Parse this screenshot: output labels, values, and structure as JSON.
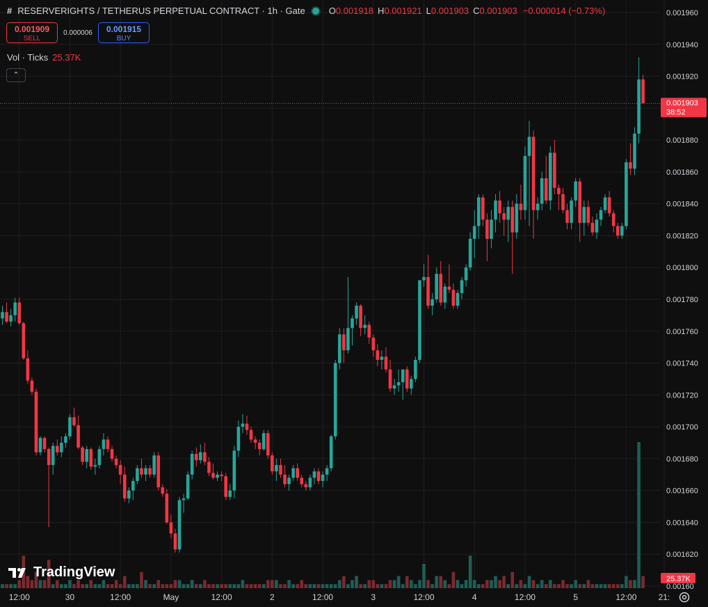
{
  "header": {
    "symbol_icon": "hash-icon",
    "title": "RESERVERIGHTS / TETHERUS PERPETUAL CONTRACT · 1h · Gate",
    "status_color": "#26a69a",
    "ohlc": {
      "o_label": "O",
      "o": "0.001918",
      "h_label": "H",
      "h": "0.001921",
      "l_label": "L",
      "l": "0.001903",
      "c_label": "C",
      "c": "0.001903",
      "change": "−0.000014 (−0.73%)"
    }
  },
  "trade": {
    "sell_price": "0.001909",
    "sell_label": "SELL",
    "spread": "0.000006",
    "buy_price": "0.001915",
    "buy_label": "BUY"
  },
  "volume_legend": {
    "label": "Vol · Ticks",
    "value": "25.37K"
  },
  "collapse_icon": "chevron-up-icon",
  "watermark": {
    "text": "TradingView",
    "icon": "tradingview-logo-icon"
  },
  "price_tag": {
    "price": "0.001903",
    "countdown": "38:52",
    "color": "#f23645"
  },
  "volume_tag": {
    "value": "25.37K",
    "color": "#f23645"
  },
  "colors": {
    "up": "#26a69a",
    "down": "#f23645",
    "up_vol": "#1e5e57",
    "down_vol": "#7a2a30",
    "grid": "#1f1f1f",
    "background": "#0f0f0f"
  },
  "chart_data": {
    "type": "candlestick",
    "ylim": [
      0.0016,
      0.00196
    ],
    "y_ticks": [
      "0.001960",
      "0.001940",
      "0.001920",
      "0.001900",
      "0.001880",
      "0.001860",
      "0.001840",
      "0.001820",
      "0.001800",
      "0.001780",
      "0.001760",
      "0.001740",
      "0.001720",
      "0.001700",
      "0.001680",
      "0.001660",
      "0.001640",
      "0.001620",
      "0.00160"
    ],
    "x_ticks": [
      {
        "label": "12:00",
        "index": 4
      },
      {
        "label": "30",
        "index": 16
      },
      {
        "label": "12:00",
        "index": 28
      },
      {
        "label": "May",
        "index": 40
      },
      {
        "label": "12:00",
        "index": 52
      },
      {
        "label": "2",
        "index": 64
      },
      {
        "label": "12:00",
        "index": 76
      },
      {
        "label": "3",
        "index": 88
      },
      {
        "label": "12:00",
        "index": 100
      },
      {
        "label": "4",
        "index": 112
      },
      {
        "label": "12:00",
        "index": 124
      },
      {
        "label": "5",
        "index": 136
      },
      {
        "label": "12:00",
        "index": 148
      },
      {
        "label": "21:",
        "index": 157
      }
    ],
    "candles": [
      [
        0.001768,
        0.001776,
        0.001764,
        0.001772,
        1
      ],
      [
        0.001772,
        0.001778,
        0.001765,
        0.001766,
        1
      ],
      [
        0.001766,
        0.001774,
        0.001763,
        0.00177,
        1
      ],
      [
        0.00177,
        0.001781,
        0.001766,
        0.001778,
        1
      ],
      [
        0.001778,
        0.001781,
        0.001764,
        0.001765,
        2
      ],
      [
        0.001765,
        0.001766,
        0.001742,
        0.001743,
        8
      ],
      [
        0.001743,
        0.001748,
        0.001727,
        0.001729,
        3
      ],
      [
        0.001729,
        0.001731,
        0.00172,
        0.001722,
        2
      ],
      [
        0.001722,
        0.001724,
        0.001682,
        0.001684,
        4
      ],
      [
        0.001684,
        0.001694,
        0.001682,
        0.001693,
        2
      ],
      [
        0.001693,
        0.001694,
        0.001684,
        0.001686,
        2
      ],
      [
        0.001686,
        0.001687,
        0.001637,
        0.001676,
        7
      ],
      [
        0.001676,
        0.00169,
        0.00167,
        0.001688,
        1
      ],
      [
        0.001688,
        0.001692,
        0.001682,
        0.001684,
        2
      ],
      [
        0.001684,
        0.001694,
        0.001681,
        0.00169,
        1
      ],
      [
        0.00169,
        0.001696,
        0.001687,
        0.001694,
        1
      ],
      [
        0.001694,
        0.001708,
        0.001692,
        0.001706,
        2
      ],
      [
        0.001706,
        0.001712,
        0.0017,
        0.001701,
        1
      ],
      [
        0.001701,
        0.001707,
        0.001686,
        0.001687,
        2
      ],
      [
        0.001687,
        0.001688,
        0.001676,
        0.001678,
        1
      ],
      [
        0.001678,
        0.001688,
        0.001674,
        0.001686,
        1
      ],
      [
        0.001686,
        0.001687,
        0.001673,
        0.001675,
        2
      ],
      [
        0.001675,
        0.00168,
        0.00167,
        0.001676,
        1
      ],
      [
        0.001676,
        0.001688,
        0.001674,
        0.001686,
        1
      ],
      [
        0.001686,
        0.001696,
        0.001682,
        0.001692,
        2
      ],
      [
        0.001692,
        0.001694,
        0.001684,
        0.001686,
        1
      ],
      [
        0.001686,
        0.001688,
        0.001678,
        0.00168,
        1
      ],
      [
        0.00168,
        0.001682,
        0.001674,
        0.001676,
        2
      ],
      [
        0.001676,
        0.001679,
        0.001664,
        0.00167,
        1
      ],
      [
        0.00167,
        0.001675,
        0.001653,
        0.001655,
        3
      ],
      [
        0.001655,
        0.001662,
        0.001652,
        0.00166,
        1
      ],
      [
        0.00166,
        0.001668,
        0.001654,
        0.001666,
        1
      ],
      [
        0.001666,
        0.001676,
        0.001664,
        0.001674,
        1
      ],
      [
        0.001674,
        0.00168,
        0.001668,
        0.00167,
        4
      ],
      [
        0.00167,
        0.001676,
        0.001666,
        0.001674,
        2
      ],
      [
        0.001674,
        0.001676,
        0.001668,
        0.00167,
        1
      ],
      [
        0.00167,
        0.001684,
        0.001668,
        0.001682,
        1
      ],
      [
        0.001682,
        0.001684,
        0.00166,
        0.001662,
        2
      ],
      [
        0.001662,
        0.001664,
        0.001656,
        0.001658,
        1
      ],
      [
        0.001658,
        0.001661,
        0.001639,
        0.00164,
        1
      ],
      [
        0.00164,
        0.001645,
        0.00163,
        0.001633,
        1
      ],
      [
        0.001633,
        0.001636,
        0.001621,
        0.001623,
        2
      ],
      [
        0.001623,
        0.001656,
        0.001621,
        0.001654,
        2
      ],
      [
        0.001654,
        0.001658,
        0.001646,
        0.001655,
        1
      ],
      [
        0.001655,
        0.001672,
        0.001654,
        0.00167,
        1
      ],
      [
        0.00167,
        0.001685,
        0.001667,
        0.001683,
        2
      ],
      [
        0.001683,
        0.001687,
        0.001675,
        0.001679,
        1
      ],
      [
        0.001679,
        0.001689,
        0.001677,
        0.001684,
        1
      ],
      [
        0.001684,
        0.00169,
        0.001676,
        0.001678,
        2
      ],
      [
        0.001678,
        0.001681,
        0.001669,
        0.001671,
        1
      ],
      [
        0.001671,
        0.001677,
        0.001667,
        0.001668,
        1
      ],
      [
        0.001668,
        0.001672,
        0.001666,
        0.00167,
        1
      ],
      [
        0.00167,
        0.001672,
        0.001666,
        0.001669,
        1
      ],
      [
        0.001669,
        0.001671,
        0.001654,
        0.001656,
        1
      ],
      [
        0.001656,
        0.001664,
        0.001654,
        0.00166,
        1
      ],
      [
        0.00166,
        0.001688,
        0.001655,
        0.001685,
        1
      ],
      [
        0.001685,
        0.001704,
        0.001681,
        0.0017,
        1
      ],
      [
        0.0017,
        0.001708,
        0.001696,
        0.001702,
        2
      ],
      [
        0.001702,
        0.001707,
        0.001695,
        0.001698,
        1
      ],
      [
        0.001698,
        0.0017,
        0.00169,
        0.001692,
        1
      ],
      [
        0.001692,
        0.001694,
        0.001686,
        0.00169,
        1
      ],
      [
        0.00169,
        0.001692,
        0.001682,
        0.001686,
        1
      ],
      [
        0.001686,
        0.001698,
        0.001685,
        0.001696,
        1
      ],
      [
        0.001696,
        0.001698,
        0.00168,
        0.001682,
        2
      ],
      [
        0.001682,
        0.001684,
        0.00167,
        0.001672,
        2
      ],
      [
        0.001672,
        0.00168,
        0.001666,
        0.001676,
        2
      ],
      [
        0.001676,
        0.00168,
        0.001668,
        0.00167,
        1
      ],
      [
        0.00167,
        0.001676,
        0.001662,
        0.001664,
        1
      ],
      [
        0.001664,
        0.00167,
        0.00166,
        0.001668,
        2
      ],
      [
        0.001668,
        0.001676,
        0.001666,
        0.001674,
        1
      ],
      [
        0.001674,
        0.001677,
        0.001666,
        0.001668,
        1
      ],
      [
        0.001668,
        0.00167,
        0.001662,
        0.001664,
        2
      ],
      [
        0.001664,
        0.001666,
        0.00166,
        0.001662,
        1
      ],
      [
        0.001662,
        0.00167,
        0.00166,
        0.001668,
        1
      ],
      [
        0.001668,
        0.001674,
        0.001664,
        0.001672,
        1
      ],
      [
        0.001672,
        0.001674,
        0.001664,
        0.001666,
        1
      ],
      [
        0.001666,
        0.001672,
        0.001662,
        0.00167,
        1
      ],
      [
        0.00167,
        0.001676,
        0.001666,
        0.001674,
        1
      ],
      [
        0.001674,
        0.001695,
        0.001672,
        0.001694,
        1
      ],
      [
        0.001694,
        0.001742,
        0.001692,
        0.00174,
        1
      ],
      [
        0.00174,
        0.001762,
        0.001736,
        0.001758,
        2
      ],
      [
        0.001758,
        0.001762,
        0.00174,
        0.001748,
        3
      ],
      [
        0.001748,
        0.001794,
        0.001746,
        0.001762,
        1
      ],
      [
        0.001762,
        0.00177,
        0.001751,
        0.001768,
        2
      ],
      [
        0.001768,
        0.001778,
        0.001764,
        0.001776,
        3
      ],
      [
        0.001776,
        0.001777,
        0.001757,
        0.001762,
        1
      ],
      [
        0.001762,
        0.00177,
        0.001758,
        0.001764,
        1
      ],
      [
        0.001764,
        0.001766,
        0.001752,
        0.001756,
        2
      ],
      [
        0.001756,
        0.001758,
        0.001744,
        0.001748,
        2
      ],
      [
        0.001748,
        0.001752,
        0.001738,
        0.001742,
        1
      ],
      [
        0.001742,
        0.001748,
        0.001736,
        0.001744,
        1
      ],
      [
        0.001744,
        0.00175,
        0.001734,
        0.001736,
        1
      ],
      [
        0.001736,
        0.001742,
        0.001722,
        0.001724,
        2
      ],
      [
        0.001724,
        0.00173,
        0.00172,
        0.001726,
        2
      ],
      [
        0.001726,
        0.001736,
        0.001722,
        0.001728,
        3
      ],
      [
        0.001728,
        0.00173,
        0.001717,
        0.001736,
        1
      ],
      [
        0.001736,
        0.001738,
        0.001722,
        0.001724,
        3
      ],
      [
        0.001724,
        0.001732,
        0.00172,
        0.00173,
        2
      ],
      [
        0.00173,
        0.001744,
        0.001728,
        0.001742,
        1
      ],
      [
        0.001742,
        0.00178,
        0.00174,
        0.001792,
        2
      ],
      [
        0.001792,
        0.001802,
        0.001788,
        0.001794,
        6
      ],
      [
        0.001794,
        0.001808,
        0.001774,
        0.001776,
        2
      ],
      [
        0.001776,
        0.001784,
        0.00177,
        0.00178,
        1
      ],
      [
        0.00178,
        0.0018,
        0.001778,
        0.001796,
        3
      ],
      [
        0.001796,
        0.001804,
        0.001776,
        0.001778,
        3
      ],
      [
        0.001778,
        0.00179,
        0.001774,
        0.001788,
        2
      ],
      [
        0.001788,
        0.001802,
        0.001784,
        0.001786,
        1
      ],
      [
        0.001786,
        0.00179,
        0.001774,
        0.001776,
        4
      ],
      [
        0.001776,
        0.001786,
        0.001774,
        0.001784,
        2
      ],
      [
        0.001784,
        0.001794,
        0.00178,
        0.001792,
        1
      ],
      [
        0.001792,
        0.001802,
        0.001788,
        0.0018,
        2
      ],
      [
        0.0018,
        0.001822,
        0.001798,
        0.001818,
        8
      ],
      [
        0.001818,
        0.001836,
        0.001806,
        0.001826,
        2
      ],
      [
        0.001826,
        0.001846,
        0.001818,
        0.001844,
        1
      ],
      [
        0.001844,
        0.001846,
        0.001826,
        0.00183,
        1
      ],
      [
        0.00183,
        0.001834,
        0.001804,
        0.001818,
        2
      ],
      [
        0.001818,
        0.001836,
        0.001812,
        0.00183,
        2
      ],
      [
        0.00183,
        0.001846,
        0.001822,
        0.001842,
        3
      ],
      [
        0.001842,
        0.001848,
        0.001828,
        0.001834,
        2
      ],
      [
        0.001834,
        0.001838,
        0.00182,
        0.00183,
        3
      ],
      [
        0.00183,
        0.001842,
        0.001816,
        0.001838,
        1
      ],
      [
        0.001838,
        0.001842,
        0.001796,
        0.001822,
        4
      ],
      [
        0.001822,
        0.001846,
        0.001818,
        0.00184,
        1
      ],
      [
        0.00184,
        0.001852,
        0.00183,
        0.001836,
        2
      ],
      [
        0.001836,
        0.001876,
        0.00183,
        0.00187,
        1
      ],
      [
        0.00187,
        0.001892,
        0.001826,
        0.001882,
        3
      ],
      [
        0.001882,
        0.001886,
        0.001818,
        0.001836,
        2
      ],
      [
        0.001836,
        0.001844,
        0.00183,
        0.00184,
        1
      ],
      [
        0.00184,
        0.00186,
        0.001836,
        0.001856,
        2
      ],
      [
        0.001856,
        0.00187,
        0.00184,
        0.001842,
        1
      ],
      [
        0.001842,
        0.001876,
        0.001836,
        0.001872,
        2
      ],
      [
        0.001872,
        0.00188,
        0.001846,
        0.00185,
        1
      ],
      [
        0.00185,
        0.001852,
        0.001836,
        0.001846,
        1
      ],
      [
        0.001846,
        0.00185,
        0.001834,
        0.001836,
        2
      ],
      [
        0.001836,
        0.00184,
        0.001824,
        0.001828,
        1
      ],
      [
        0.001828,
        0.001844,
        0.001824,
        0.001842,
        1
      ],
      [
        0.001842,
        0.001856,
        0.001838,
        0.001854,
        2
      ],
      [
        0.001854,
        0.001856,
        0.001816,
        0.001828,
        1
      ],
      [
        0.001828,
        0.001842,
        0.00182,
        0.001838,
        1
      ],
      [
        0.001838,
        0.001842,
        0.001826,
        0.001828,
        2
      ],
      [
        0.001828,
        0.001832,
        0.00182,
        0.001822,
        1
      ],
      [
        0.001822,
        0.001834,
        0.001818,
        0.00183,
        1
      ],
      [
        0.00183,
        0.001838,
        0.001826,
        0.001836,
        1
      ],
      [
        0.001836,
        0.001846,
        0.001834,
        0.001844,
        1
      ],
      [
        0.001844,
        0.001848,
        0.001832,
        0.001834,
        1
      ],
      [
        0.001834,
        0.001836,
        0.001822,
        0.001826,
        1
      ],
      [
        0.001826,
        0.001828,
        0.001818,
        0.00182,
        1
      ],
      [
        0.00182,
        0.001828,
        0.001818,
        0.001826,
        1
      ],
      [
        0.001826,
        0.001868,
        0.001824,
        0.001866,
        3
      ],
      [
        0.001866,
        0.001878,
        0.001858,
        0.001862,
        2
      ],
      [
        0.001862,
        0.001888,
        0.001858,
        0.001884,
        2
      ],
      [
        0.001884,
        0.001932,
        0.001878,
        0.001918,
        36
      ],
      [
        0.001918,
        0.001921,
        0.001903,
        0.001903,
        3
      ]
    ]
  }
}
